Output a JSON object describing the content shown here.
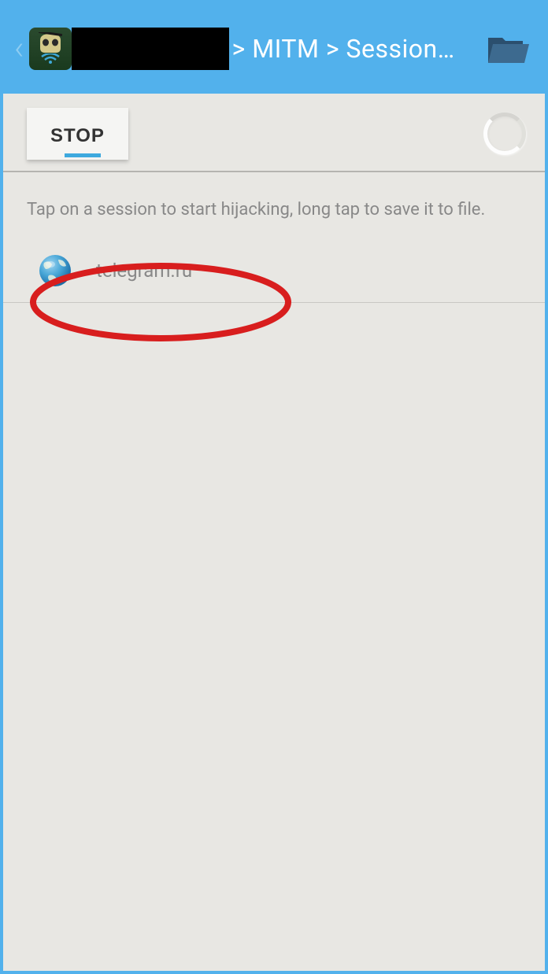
{
  "header": {
    "breadcrumb": " > MITM > Session…",
    "app_icon_name": "dsploit-icon",
    "folder_icon_name": "folder-open-icon"
  },
  "actions": {
    "stop_label": "STOP"
  },
  "instruction_text": "Tap on a session to start hijacking, long tap to save it to file.",
  "sessions": [
    {
      "label": "telegram.ru",
      "icon": "globe-icon"
    }
  ],
  "annotation": {
    "highlight": "red-ellipse"
  }
}
